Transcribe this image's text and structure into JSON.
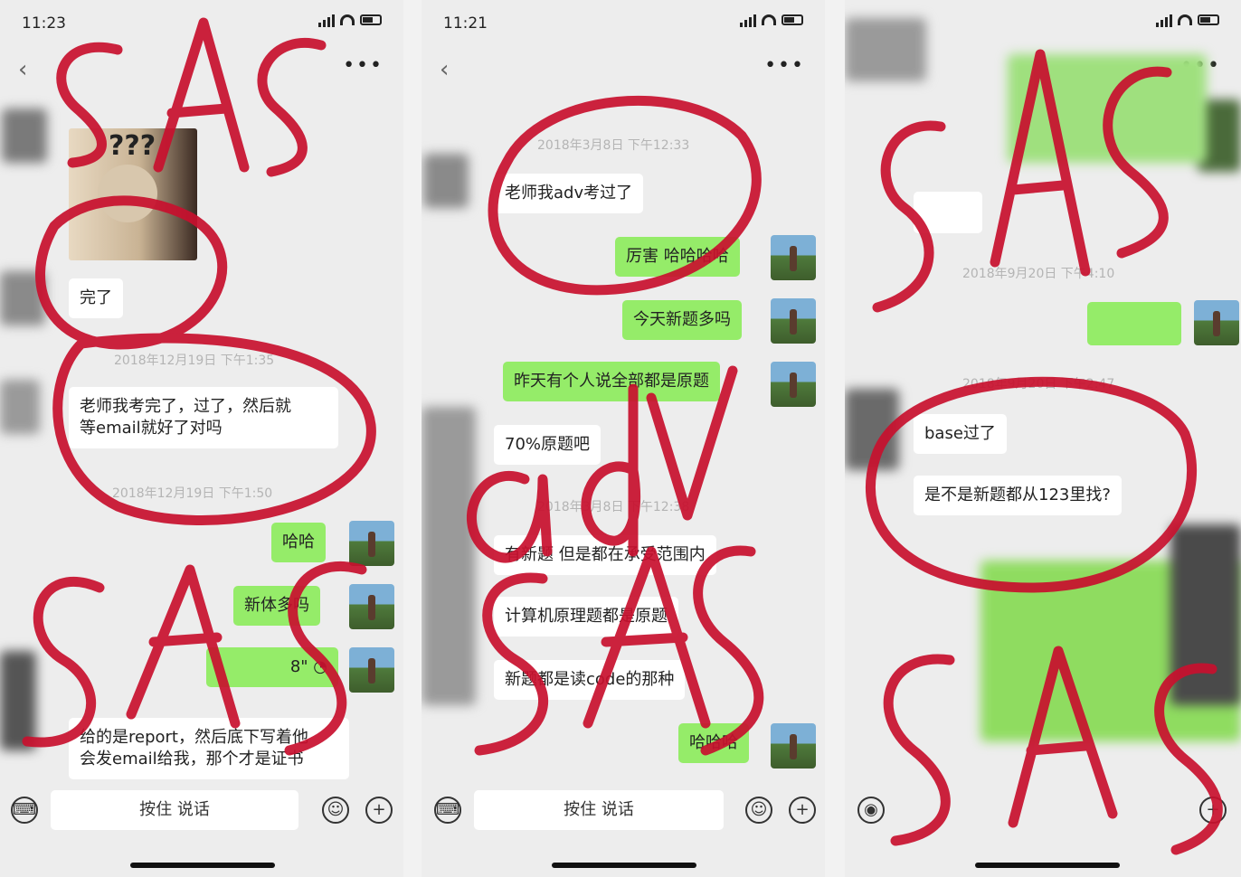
{
  "screens": [
    {
      "status_time": "11:23",
      "messages": {
        "cat_caption": "???",
        "m1": "完了",
        "ts1": "2018年12月19日 下午1:35",
        "m2a": "老师我考完了，过了，然后就",
        "m2b": "等email就好了对吗",
        "ts2": "2018年12月19日 下午1:50",
        "r1": "哈哈",
        "r2": "新体多吗",
        "voice": "8\"",
        "m3a": "给的是report，然后底下写着他",
        "m3b": "会发email给我，那个才是证书"
      },
      "input_label": "按住 说话",
      "overlay": [
        "SAS",
        "SAS"
      ]
    },
    {
      "status_time": "11:21",
      "messages": {
        "ts1": "2018年3月8日 下午12:33",
        "m1": "老师我adv考过了",
        "r1": "厉害 哈哈哈哈",
        "r2": "今天新题多吗",
        "r3": "昨天有个人说全部都是原题",
        "m2": "70%原题吧",
        "ts2": "2018年3月8日 下午12:38",
        "m3": "有新题 但是都在承受范围内",
        "m4": "计算机原理题都是原题",
        "m5": "新题都是读code的那种",
        "r4": "哈哈哈"
      },
      "input_label": "按住 说话",
      "overlay": [
        "adv",
        "SAS"
      ]
    },
    {
      "messages": {
        "ts1": "2018年9月20日 下午4:10",
        "ts2": "2018年9月20日 下午2:47",
        "m1": "base过了",
        "m2": "是不是新题都从123里找?"
      },
      "overlay": [
        "SAS",
        "SAS"
      ]
    }
  ],
  "icons": {
    "back": "chevron-left-icon",
    "more": "more-dots-icon",
    "keyboard": "keyboard-icon",
    "voice_mode": "voice-icon",
    "emoji": "emoji-icon",
    "plus": "plus-icon",
    "emoji_glyph": "☺",
    "plus_glyph": "+",
    "keyboard_glyph": "⌨",
    "voice_glyph": "◉",
    "dots_glyph": "•••",
    "back_glyph": "‹",
    "sound_glyph": "◔"
  },
  "colors": {
    "bubble_self": "#95ec69",
    "bubble_other": "#ffffff",
    "background": "#ededed",
    "ink": "#c8102e"
  }
}
